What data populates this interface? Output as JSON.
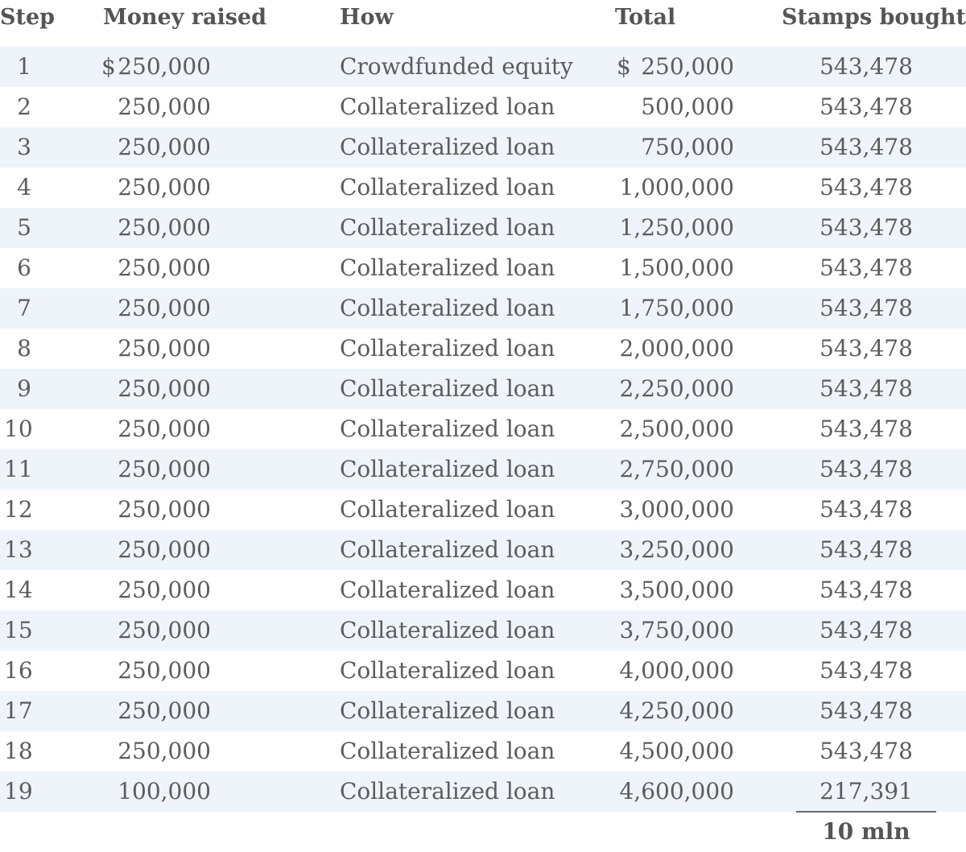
{
  "headers": {
    "step": "Step",
    "money": "Money raised",
    "how": "How",
    "total": "Total",
    "stamps": "Stamps bought"
  },
  "currency_symbol": "$",
  "rows": [
    {
      "step": "1",
      "money": "250,000",
      "how": "Crowdfunded equity",
      "total": "250,000",
      "stamps": "543,478"
    },
    {
      "step": "2",
      "money": "250,000",
      "how": "Collateralized loan",
      "total": "500,000",
      "stamps": "543,478"
    },
    {
      "step": "3",
      "money": "250,000",
      "how": "Collateralized loan",
      "total": "750,000",
      "stamps": "543,478"
    },
    {
      "step": "4",
      "money": "250,000",
      "how": "Collateralized loan",
      "total": "1,000,000",
      "stamps": "543,478"
    },
    {
      "step": "5",
      "money": "250,000",
      "how": "Collateralized loan",
      "total": "1,250,000",
      "stamps": "543,478"
    },
    {
      "step": "6",
      "money": "250,000",
      "how": "Collateralized loan",
      "total": "1,500,000",
      "stamps": "543,478"
    },
    {
      "step": "7",
      "money": "250,000",
      "how": "Collateralized loan",
      "total": "1,750,000",
      "stamps": "543,478"
    },
    {
      "step": "8",
      "money": "250,000",
      "how": "Collateralized loan",
      "total": "2,000,000",
      "stamps": "543,478"
    },
    {
      "step": "9",
      "money": "250,000",
      "how": "Collateralized loan",
      "total": "2,250,000",
      "stamps": "543,478"
    },
    {
      "step": "10",
      "money": "250,000",
      "how": "Collateralized loan",
      "total": "2,500,000",
      "stamps": "543,478"
    },
    {
      "step": "11",
      "money": "250,000",
      "how": "Collateralized loan",
      "total": "2,750,000",
      "stamps": "543,478"
    },
    {
      "step": "12",
      "money": "250,000",
      "how": "Collateralized loan",
      "total": "3,000,000",
      "stamps": "543,478"
    },
    {
      "step": "13",
      "money": "250,000",
      "how": "Collateralized loan",
      "total": "3,250,000",
      "stamps": "543,478"
    },
    {
      "step": "14",
      "money": "250,000",
      "how": "Collateralized loan",
      "total": "3,500,000",
      "stamps": "543,478"
    },
    {
      "step": "15",
      "money": "250,000",
      "how": "Collateralized loan",
      "total": "3,750,000",
      "stamps": "543,478"
    },
    {
      "step": "16",
      "money": "250,000",
      "how": "Collateralized loan",
      "total": "4,000,000",
      "stamps": "543,478"
    },
    {
      "step": "17",
      "money": "250,000",
      "how": "Collateralized loan",
      "total": "4,250,000",
      "stamps": "543,478"
    },
    {
      "step": "18",
      "money": "250,000",
      "how": "Collateralized loan",
      "total": "4,500,000",
      "stamps": "543,478"
    },
    {
      "step": "19",
      "money": "100,000",
      "how": "Collateralized loan",
      "total": "4,600,000",
      "stamps": "217,391"
    }
  ],
  "summary": {
    "stamps_total": "10 mln"
  },
  "colors": {
    "row_shade": "#eef4fa",
    "text": "#5c5c5c"
  }
}
